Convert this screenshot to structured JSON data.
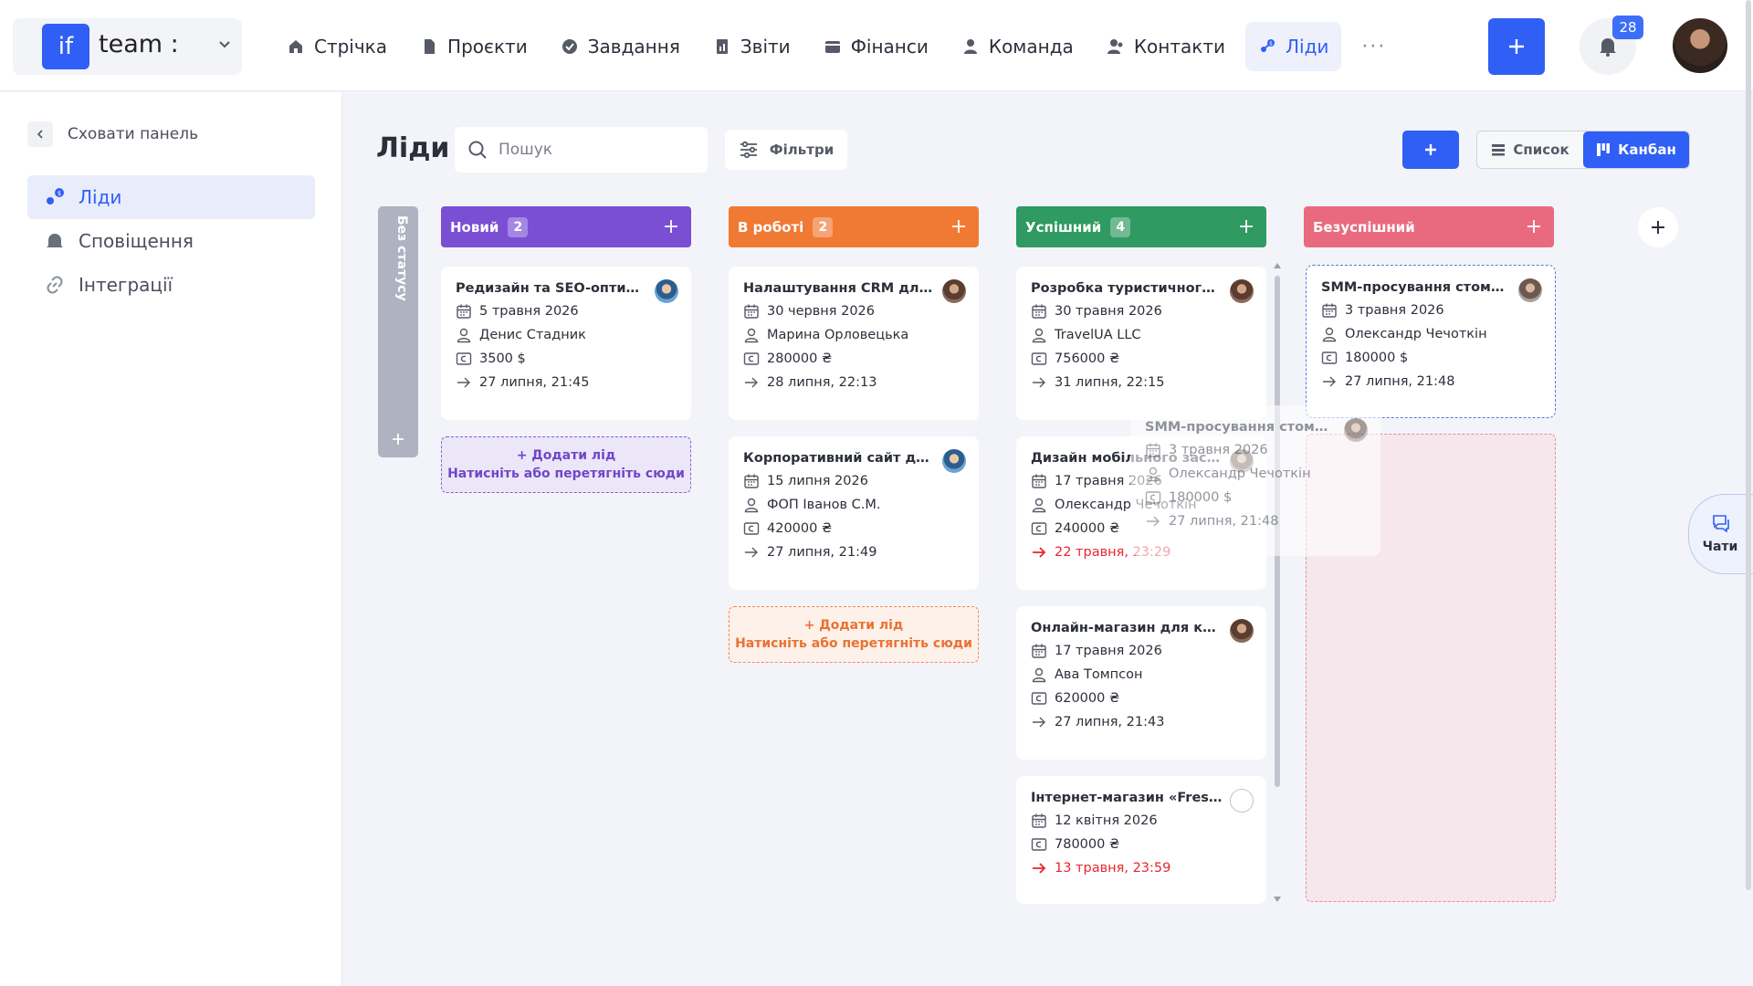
{
  "brand": {
    "logo": "if",
    "name": "team :"
  },
  "nav": [
    {
      "label": "Стрічка",
      "icon": "home-icon"
    },
    {
      "label": "Проєкти",
      "icon": "file-icon"
    },
    {
      "label": "Завдання",
      "icon": "check-circle-icon"
    },
    {
      "label": "Звіти",
      "icon": "report-icon"
    },
    {
      "label": "Фінанси",
      "icon": "wallet-icon"
    },
    {
      "label": "Команда",
      "icon": "person-icon"
    },
    {
      "label": "Контакти",
      "icon": "contacts-icon"
    },
    {
      "label": "Ліди",
      "icon": "leads-icon",
      "active": true
    }
  ],
  "nav_more": "···",
  "notifications": {
    "count": "28"
  },
  "sidebar": {
    "hide_label": "Сховати панель",
    "items": [
      {
        "label": "Ліди",
        "active": true
      },
      {
        "label": "Сповіщення"
      },
      {
        "label": "Інтеграції"
      }
    ]
  },
  "header": {
    "title": "Ліди",
    "search_placeholder": "Пошук",
    "filters_label": "Фільтри",
    "view_list": "Список",
    "view_kanban": "Канбан"
  },
  "colors": {
    "accent": "#2f5ff5",
    "col_new": "#7a4fd4",
    "col_in_progress": "#f07a34",
    "col_success": "#2f9a62",
    "col_failed": "#e96a7e",
    "no_status": "#aeb2c1",
    "overdue": "#e8262c"
  },
  "no_status_label": "Без статусу",
  "columns": [
    {
      "name": "Новий",
      "count": "2",
      "add": {
        "title": "+ Додати лід",
        "hint": "Натисніть або перетягніть сюди"
      },
      "cards": [
        {
          "title": "Редизайн та SEO-оптимізація",
          "date": "5 травня 2026",
          "person": "Денис Стадник",
          "amount": "3500 $",
          "deadline": "27 липня, 21:45"
        }
      ]
    },
    {
      "name": "В роботі",
      "count": "2",
      "add": {
        "title": "+ Додати лід",
        "hint": "Натисніть або перетягніть сюди"
      },
      "cards": [
        {
          "title": "Налаштування CRM для відділу",
          "date": "30 червня 2026",
          "person": "Марина Орловецька",
          "amount": "280000 ₴",
          "deadline": "28 липня, 22:13"
        },
        {
          "title": "Корпоративний сайт для логістики",
          "date": "15 липня 2026",
          "person": "ФОП Іванов С.М.",
          "amount": "420000 ₴",
          "deadline": "27 липня, 21:49"
        }
      ]
    },
    {
      "name": "Успішний",
      "count": "4",
      "cards": [
        {
          "title": "Розробка туристичного веб-сайту",
          "date": "30 травня 2026",
          "person": "TravelUA LLC",
          "amount": "756000 ₴",
          "deadline": "31 липня, 22:15"
        },
        {
          "title": "Дизайн мобільного застосунку",
          "date": "17 травня 2026",
          "person": "Олександр Чечоткін",
          "amount": "240000 ₴",
          "deadline": "22 травня, 23:29"
        },
        {
          "title": "Онлайн-магазин для косметики",
          "date": "17 травня 2026",
          "person": "Ава Томпсон",
          "amount": "620000 ₴",
          "deadline": "27 липня, 21:43"
        },
        {
          "title": "Інтернет-магазин «FreshMarket»",
          "date": "12 квітня 2026",
          "amount": "780000 ₴",
          "deadline": "13 травня, 23:59"
        }
      ]
    },
    {
      "name": "Безуспішний",
      "cards": [
        {
          "title": "SMM-просування стоматології",
          "date": "3 травня 2026",
          "person": "Олександр Чечоткін",
          "amount": "180000 $",
          "deadline": "27 липня, 21:48"
        }
      ]
    }
  ],
  "dragged_card": {
    "title": "SMM-просування стоматології",
    "date": "3 травня 2026",
    "person": "Олександр Чечоткін",
    "amount": "180000 $",
    "deadline": "27 липня, 21:48"
  },
  "chats_label": "Чати"
}
